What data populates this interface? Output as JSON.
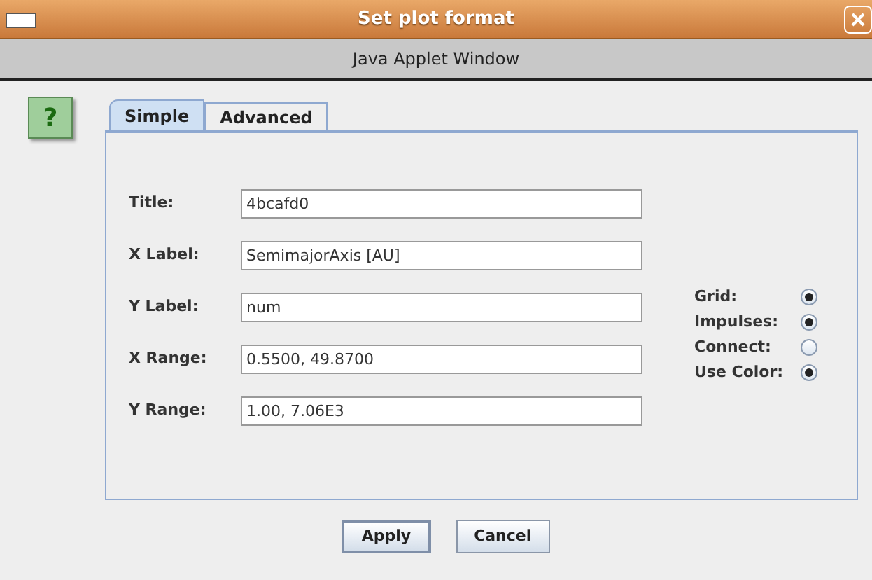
{
  "window": {
    "title": "Set plot format",
    "subtitle": "Java Applet Window"
  },
  "help": {
    "label": "?"
  },
  "tabs": [
    {
      "label": "Simple",
      "selected": true
    },
    {
      "label": "Advanced",
      "selected": false
    }
  ],
  "fields": [
    {
      "label": "Title:",
      "value": "4bcafd0"
    },
    {
      "label": "X Label:",
      "value": "SemimajorAxis [AU]"
    },
    {
      "label": "Y Label:",
      "value": "num"
    },
    {
      "label": "X Range:",
      "value": "0.5500, 49.8700"
    },
    {
      "label": "Y Range:",
      "value": "1.00, 7.06E3"
    }
  ],
  "options": [
    {
      "label": "Grid:",
      "checked": true
    },
    {
      "label": "Impulses:",
      "checked": true
    },
    {
      "label": "Connect:",
      "checked": false
    },
    {
      "label": "Use Color:",
      "checked": true
    }
  ],
  "buttons": [
    "Apply",
    "Cancel"
  ]
}
